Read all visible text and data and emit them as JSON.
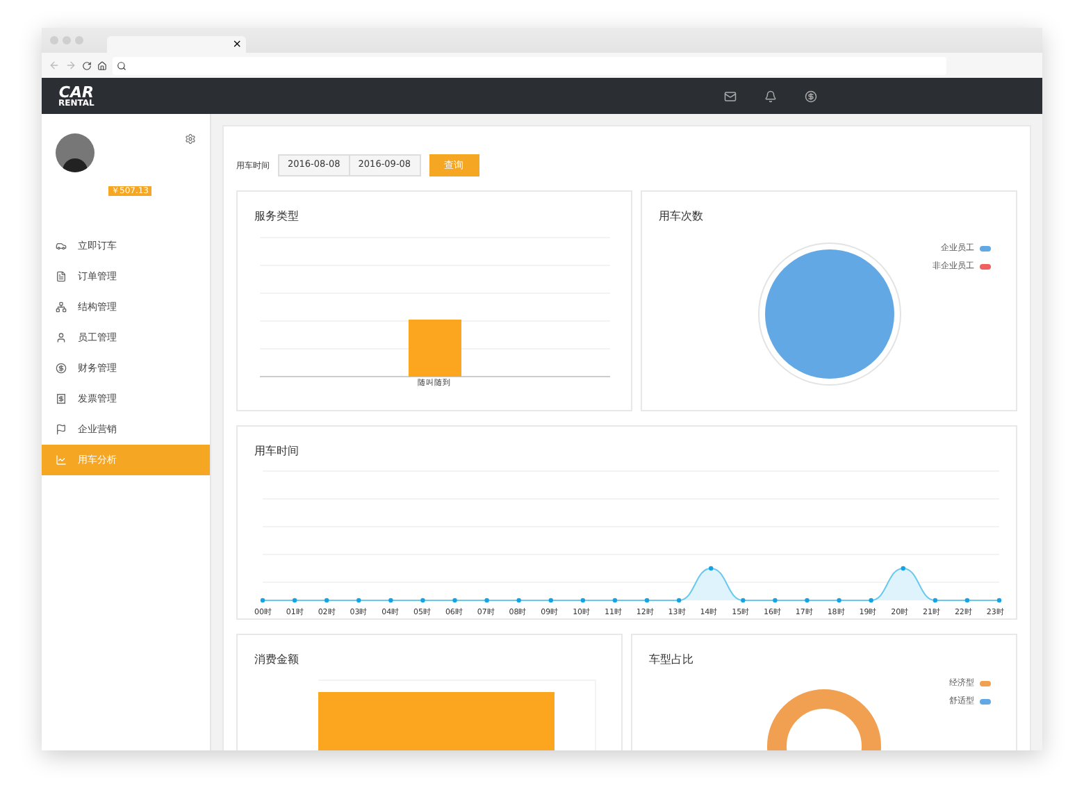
{
  "browser": {
    "tab_close": "×"
  },
  "header": {
    "logo": "CAR",
    "logo_sub": "RENTAL"
  },
  "profile": {
    "balance": "￥507.13"
  },
  "sidebar": {
    "items": [
      {
        "label": "立即订车",
        "selected": false
      },
      {
        "label": "订单管理",
        "selected": false
      },
      {
        "label": "结构管理",
        "selected": false
      },
      {
        "label": "员工管理",
        "selected": false
      },
      {
        "label": "财务管理",
        "selected": false
      },
      {
        "label": "发票管理",
        "selected": false
      },
      {
        "label": "企业营销",
        "selected": false
      },
      {
        "label": "用车分析",
        "selected": true
      }
    ]
  },
  "filter": {
    "label": "用车时间",
    "start": "2016-08-08",
    "end": "2016-09-08",
    "button": "查询"
  },
  "service_type": {
    "title": "服务类型",
    "categories": [
      "随叫随到"
    ]
  },
  "usage_count": {
    "title": "用车次数",
    "legend": [
      {
        "label": "企业员工",
        "color": "#62a8e5"
      },
      {
        "label": "非企业员工",
        "color": "#f06060"
      }
    ]
  },
  "usage_time": {
    "title": "用车时间",
    "hours": [
      "00时",
      "01时",
      "02时",
      "03时",
      "04时",
      "05时",
      "06时",
      "07时",
      "08时",
      "09时",
      "10时",
      "11时",
      "12时",
      "13时",
      "14时",
      "15时",
      "16时",
      "17时",
      "18时",
      "19时",
      "20时",
      "21时",
      "22时",
      "23时"
    ]
  },
  "spending": {
    "title": "消费金额"
  },
  "car_type": {
    "title": "车型占比",
    "legend": [
      {
        "label": "经济型",
        "color": "#f0a050"
      },
      {
        "label": "舒适型",
        "color": "#62a8e5"
      }
    ]
  }
}
